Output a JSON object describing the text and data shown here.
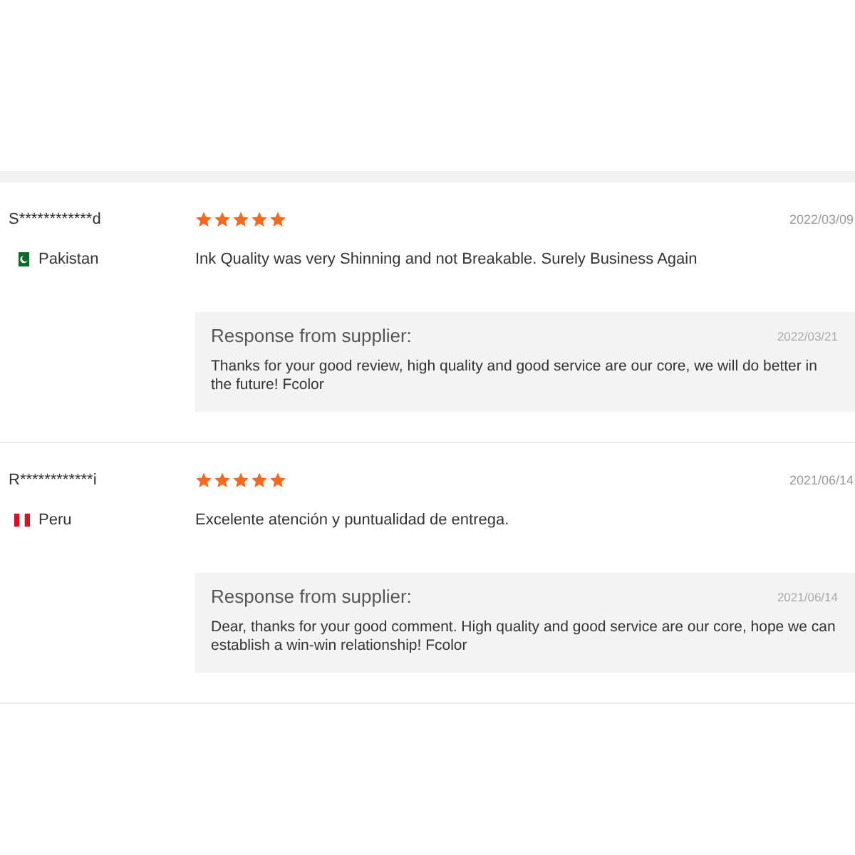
{
  "reviews": [
    {
      "user": "S************d",
      "stars": 5,
      "date": "2022/03/09",
      "flag": {
        "kind": "crescent"
      },
      "country": "Pakistan",
      "comment": "Ink Quality was very Shinning and not Breakable. Surely Business Again",
      "response": {
        "title": "Response from supplier:",
        "date": "2022/03/21",
        "text": "Thanks for your good review, high quality and good service are our core, we will do better in the future! Fcolor"
      }
    },
    {
      "user": "R************i",
      "stars": 5,
      "date": "2021/06/14",
      "flag": {
        "kind": "stripes"
      },
      "country": "Peru",
      "comment": "Excelente atención y puntualidad de entrega.",
      "response": {
        "title": "Response from supplier:",
        "date": "2021/06/14",
        "text": "Dear, thanks for your good comment. High quality and good service are our core, hope we can establish a win-win relationship! Fcolor"
      }
    }
  ]
}
